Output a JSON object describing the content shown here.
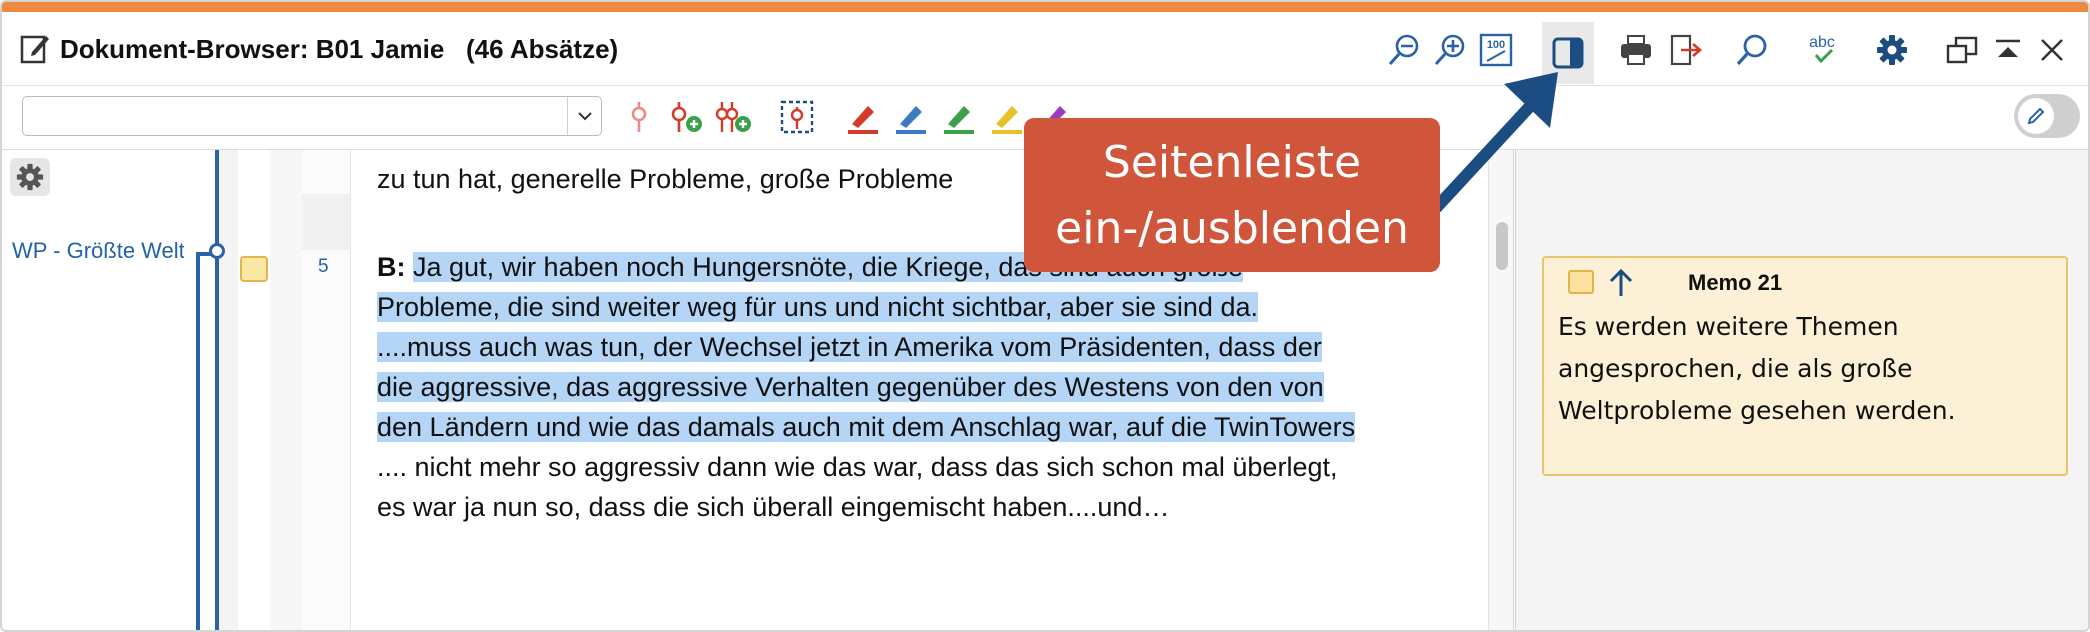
{
  "window": {
    "title": "Dokument-Browser: B01 Jamie   (46 Absätze)",
    "accent_color": "#ee8a40"
  },
  "title_icons": [
    {
      "name": "zoom-out-icon"
    },
    {
      "name": "zoom-in-icon"
    },
    {
      "name": "zoom-100-icon",
      "text": "100"
    },
    {
      "name": "sidebar-toggle-icon"
    },
    {
      "name": "print-icon"
    },
    {
      "name": "export-icon"
    },
    {
      "name": "search-icon"
    },
    {
      "name": "spellcheck-icon",
      "text": "abc"
    },
    {
      "name": "settings-gear-icon"
    },
    {
      "name": "undock-window-icon"
    },
    {
      "name": "collapse-window-icon"
    },
    {
      "name": "close-icon"
    }
  ],
  "toolbar": {
    "combo_value": "",
    "icons": [
      "code-icon",
      "code-add-icon",
      "code-multiple-add-icon",
      "code-area-icon",
      "highlighter-red-icon",
      "highlighter-blue-icon",
      "highlighter-green-icon",
      "highlighter-yellow-icon",
      "highlighter-purple-icon",
      "emoticon-icon",
      "symbol-icon",
      "link-icon",
      "link-grey-icon"
    ],
    "edit_toggle": "edit-mode-toggle"
  },
  "left_panel": {
    "code_label": "WP - Größte Weltprobleme",
    "paragraph_number": "5"
  },
  "document": {
    "lines": [
      {
        "text": "zu tun hat, generelle Probleme, große Probleme",
        "highlight": false
      },
      {
        "speaker": "B:",
        "text": "Ja gut, wir haben noch Hungersnöte, die Kriege, das sind auch große",
        "highlight": true
      },
      {
        "text": "Probleme, die sind weiter weg für uns und nicht sichtbar, aber sie sind da.",
        "highlight": true
      },
      {
        "text": "....muss auch was tun, der Wechsel jetzt in Amerika vom Präsidenten, dass der",
        "highlight": true
      },
      {
        "text": "die aggressive, das aggressive Verhalten gegenüber des Westens von den von",
        "highlight": true
      },
      {
        "text": "den Ländern und wie das damals auch mit dem Anschlag war, auf die TwinTowers",
        "highlight": true
      },
      {
        "text": ".... nicht mehr so aggressiv dann wie das war, dass das sich schon mal überlegt,",
        "highlight": false
      },
      {
        "text": "es war ja nun so, dass die sich überall eingemischt haben....und…",
        "highlight": false
      }
    ]
  },
  "memo": {
    "title": "Memo 21",
    "body": "Es werden weitere Themen angesprochen, die als große Weltprobleme gesehen werden."
  },
  "callout": {
    "line1": "Seitenleiste",
    "line2": "ein-/ausblenden",
    "color": "#cf553b",
    "arrow_color": "#1c4d82"
  }
}
